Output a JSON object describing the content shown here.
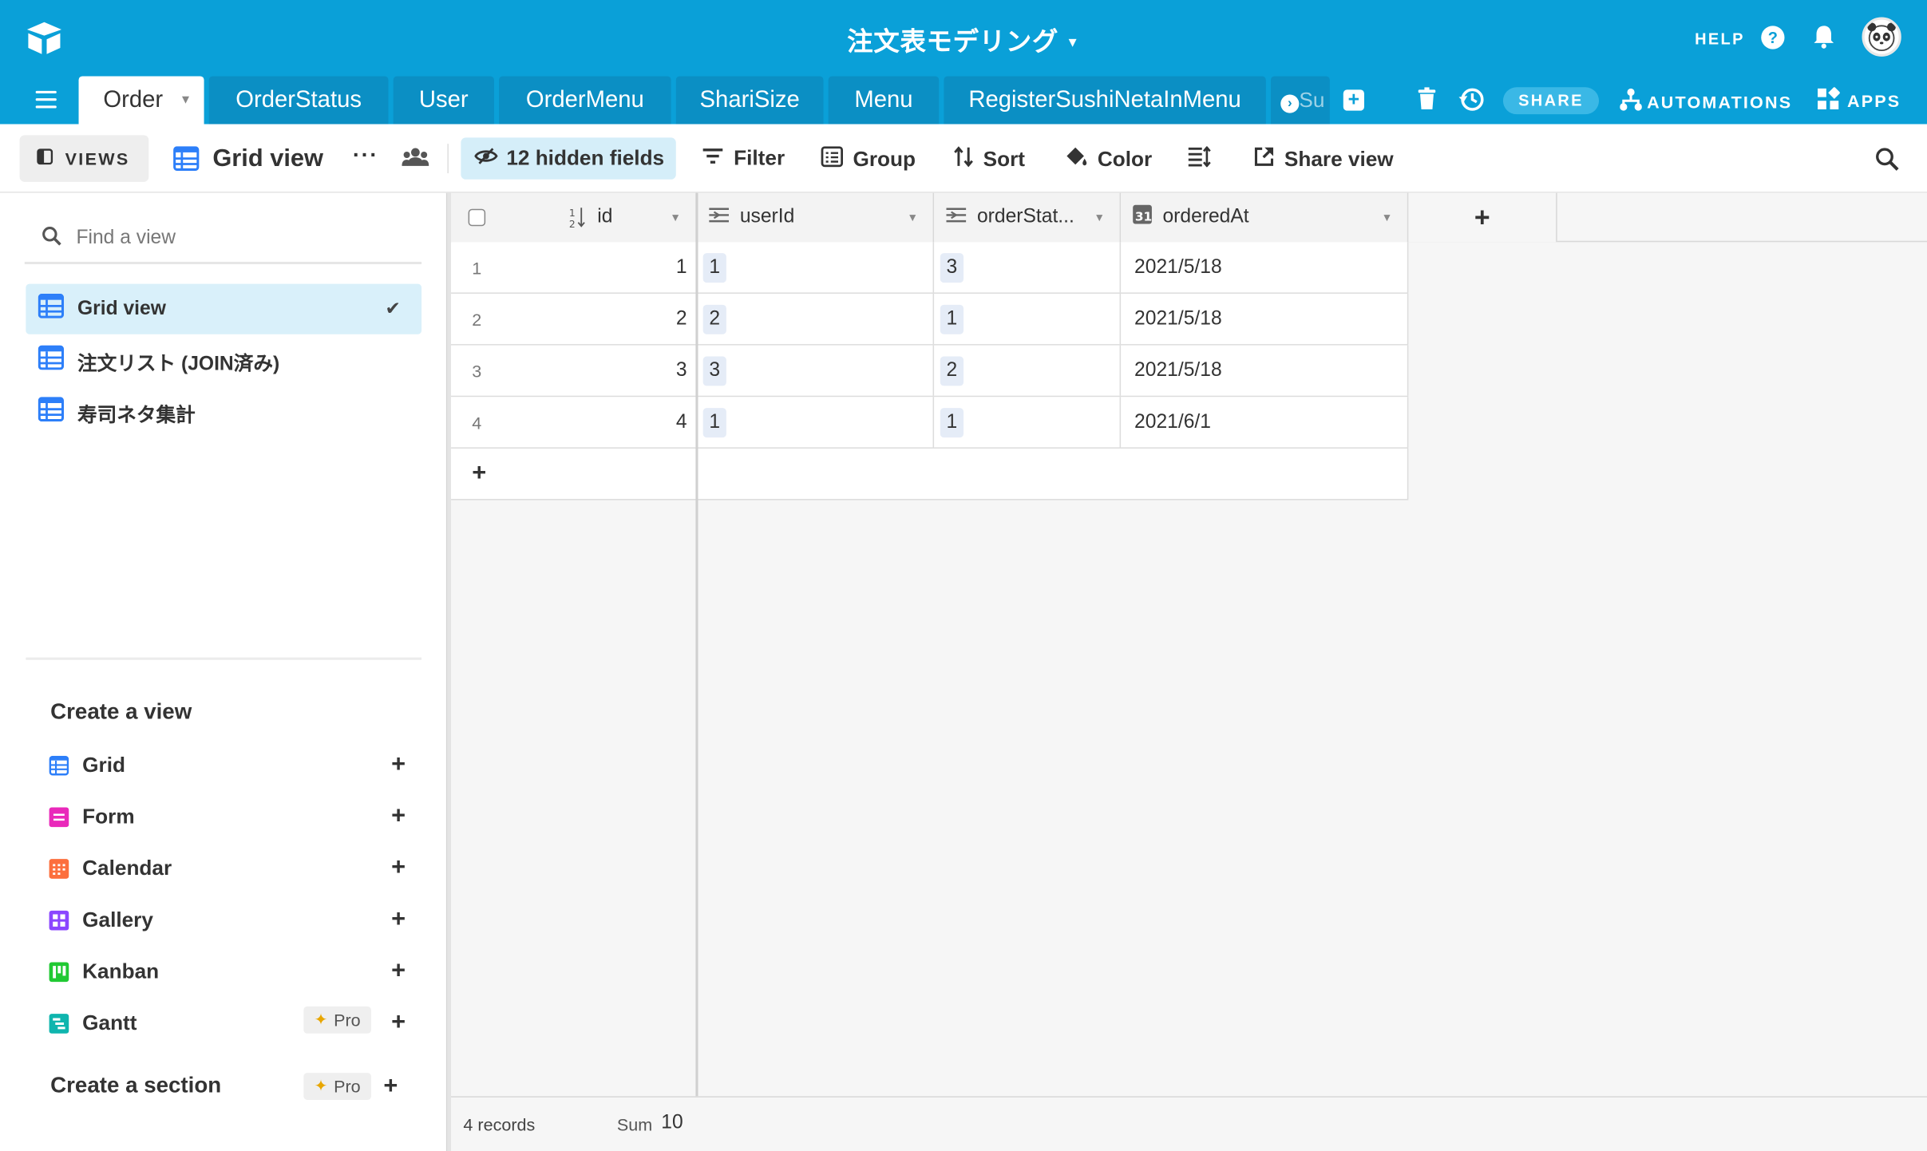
{
  "app": {
    "base_title": "注文表モデリング",
    "help_label": "HELP",
    "share_label": "SHARE",
    "automations_label": "AUTOMATIONS",
    "apps_label": "APPS"
  },
  "tabs": [
    {
      "label": "Order",
      "active": true
    },
    {
      "label": "OrderStatus"
    },
    {
      "label": "User"
    },
    {
      "label": "OrderMenu"
    },
    {
      "label": "ShariSize"
    },
    {
      "label": "Menu"
    },
    {
      "label": "RegisterSushiNetaInMenu"
    },
    {
      "label": "Su"
    }
  ],
  "toolbar": {
    "views_label": "VIEWS",
    "view_name": "Grid view",
    "more_label": "···",
    "hidden_fields_label": "12 hidden fields",
    "filter_label": "Filter",
    "group_label": "Group",
    "sort_label": "Sort",
    "color_label": "Color",
    "share_view_label": "Share view"
  },
  "sidebar": {
    "find_placeholder": "Find a view",
    "views": [
      {
        "label": "Grid view",
        "selected": true
      },
      {
        "label": "注文リスト (JOIN済み)"
      },
      {
        "label": "寿司ネタ集計"
      }
    ],
    "create_view_heading": "Create a view",
    "create_items": [
      {
        "label": "Grid",
        "color": "#2d7ff9"
      },
      {
        "label": "Form",
        "color": "#e929ba"
      },
      {
        "label": "Calendar",
        "color": "#fc6f3d"
      },
      {
        "label": "Gallery",
        "color": "#8b46ff"
      },
      {
        "label": "Kanban",
        "color": "#20c933"
      },
      {
        "label": "Gantt",
        "color": "#0fb5ae",
        "pro": true
      }
    ],
    "pro_label": "Pro",
    "create_section_label": "Create a section"
  },
  "grid": {
    "columns": [
      "id",
      "userId",
      "orderStat...",
      "orderedAt"
    ],
    "rows": [
      {
        "num": "1",
        "id": "1",
        "userId": "1",
        "orderStatus": "3",
        "orderedAt": "2021/5/18"
      },
      {
        "num": "2",
        "id": "2",
        "userId": "2",
        "orderStatus": "1",
        "orderedAt": "2021/5/18"
      },
      {
        "num": "3",
        "id": "3",
        "userId": "3",
        "orderStatus": "2",
        "orderedAt": "2021/5/18"
      },
      {
        "num": "4",
        "id": "4",
        "userId": "1",
        "orderStatus": "1",
        "orderedAt": "2021/6/1"
      }
    ],
    "add_row_label": "+",
    "add_field_label": "+",
    "footer_records": "4 records",
    "footer_sum_label": "Sum",
    "footer_sum_value": "10"
  },
  "colors": {
    "brand": "#0aa0d8",
    "tab_inactive": "#0b8fc4",
    "selected_view_bg": "#d9f0fa",
    "hidden_fields_bg": "#d5eef9"
  }
}
